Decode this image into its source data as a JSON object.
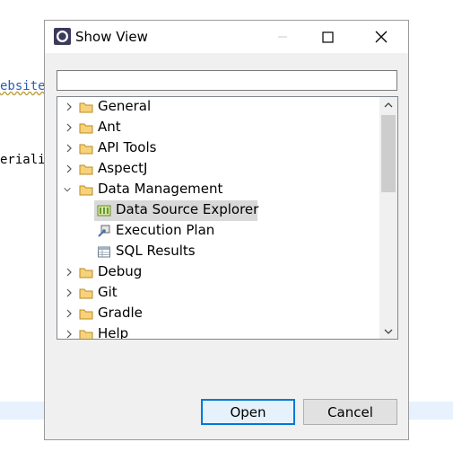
{
  "background": {
    "link_text": "ebsite",
    "code_text": "eriali"
  },
  "dialog": {
    "title": "Show View",
    "filter": {
      "value": "",
      "placeholder": ""
    },
    "tree": [
      {
        "label": "General",
        "icon": "folder-icon",
        "expanded": false
      },
      {
        "label": "Ant",
        "icon": "folder-icon",
        "expanded": false
      },
      {
        "label": "API Tools",
        "icon": "folder-icon",
        "expanded": false
      },
      {
        "label": "AspectJ",
        "icon": "folder-icon",
        "expanded": false
      },
      {
        "label": "Data Management",
        "icon": "folder-icon",
        "expanded": true
      },
      {
        "label": "Data Source Explorer",
        "icon": "data-source-explorer-icon",
        "selected": true
      },
      {
        "label": "Execution Plan",
        "icon": "execution-plan-icon"
      },
      {
        "label": "SQL Results",
        "icon": "sql-results-icon"
      },
      {
        "label": "Debug",
        "icon": "folder-icon",
        "expanded": false
      },
      {
        "label": "Git",
        "icon": "folder-icon",
        "expanded": false
      },
      {
        "label": "Gradle",
        "icon": "folder-icon",
        "expanded": false
      },
      {
        "label": "Help",
        "icon": "folder-icon",
        "expanded": false
      }
    ],
    "buttons": {
      "open": "Open",
      "cancel": "Cancel"
    }
  },
  "colors": {
    "accent": "#0078d7",
    "folder": "#e8b94b",
    "selection": "#d9d9d9"
  }
}
